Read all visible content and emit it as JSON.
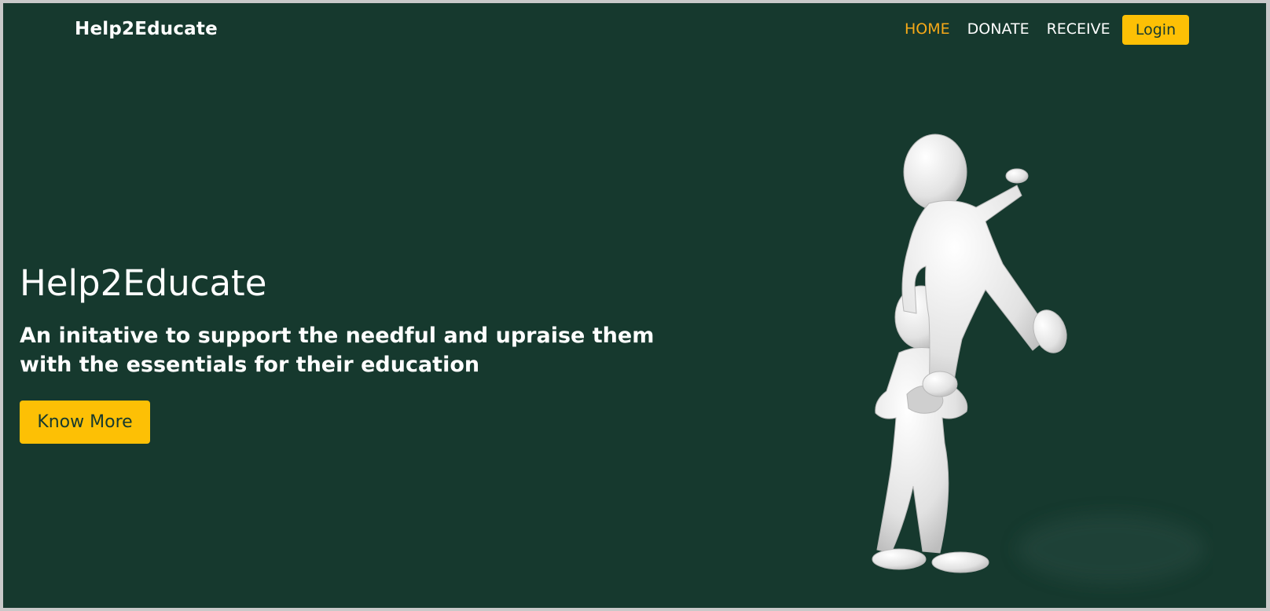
{
  "navbar": {
    "brand": "Help2Educate",
    "links": [
      {
        "label": "HOME",
        "active": true
      },
      {
        "label": "DONATE",
        "active": false
      },
      {
        "label": "RECEIVE",
        "active": false
      }
    ],
    "login_label": "Login"
  },
  "hero": {
    "title": "Help2Educate",
    "subtitle": "An initative to support the needful and upraise them with the essentials for their education",
    "cta_label": "Know More",
    "illustration": "two-figures-helping-icon"
  },
  "colors": {
    "background": "#16392e",
    "accent": "#fdc005",
    "active_link": "#f6a918",
    "text": "#ffffff"
  }
}
